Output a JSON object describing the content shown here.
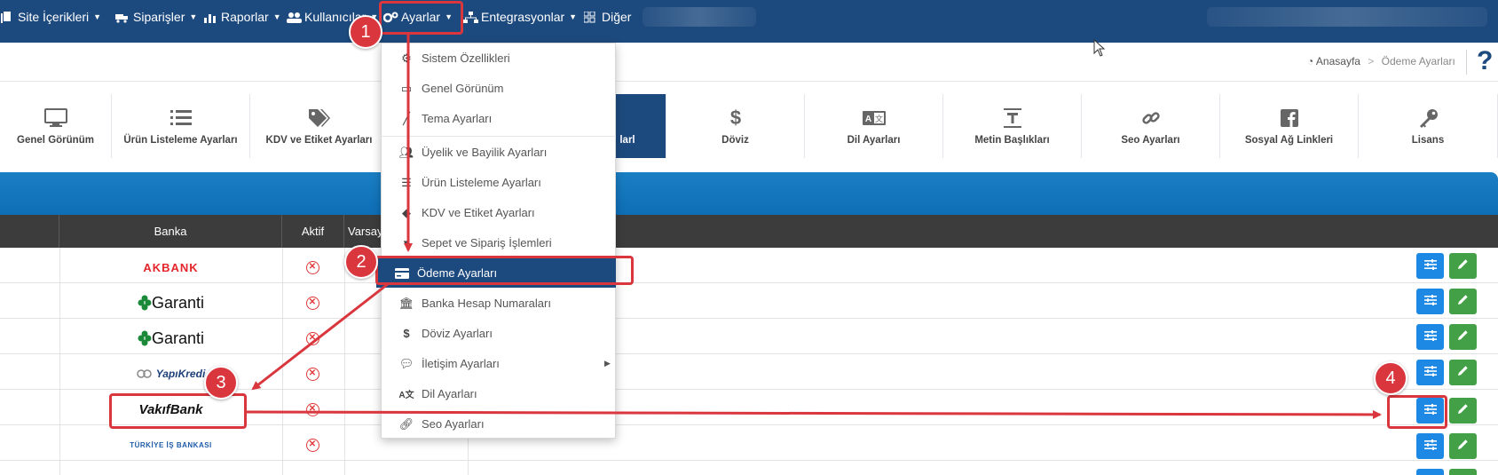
{
  "topnav": {
    "items": [
      {
        "label": "Site İçerikleri",
        "icon": "document-icon"
      },
      {
        "label": "Siparişler",
        "icon": "truck-icon"
      },
      {
        "label": "Raporlar",
        "icon": "chart-icon"
      },
      {
        "label": "Kullanıcılar",
        "icon": "users-icon"
      },
      {
        "label": "Ayarlar",
        "icon": "gears-icon"
      },
      {
        "label": "Entegrasyonlar",
        "icon": "sitemap-icon"
      },
      {
        "label": "Diğer",
        "icon": "grid-icon"
      }
    ]
  },
  "breadcrumb": {
    "home": "Anasayfa",
    "separator": ">",
    "current": "Ödeme Ayarları"
  },
  "help_label": "?",
  "tabs": [
    {
      "label": "Genel Görünüm",
      "icon": "monitor-icon"
    },
    {
      "label": "Ürün Listeleme Ayarları",
      "icon": "list-icon"
    },
    {
      "label": "KDV ve Etiket Ayarları",
      "icon": "tags-icon"
    },
    {
      "label": "larl",
      "icon": ""
    },
    {
      "label": "Döviz",
      "icon": "dollar-icon"
    },
    {
      "label": "Dil Ayarları",
      "icon": "language-icon"
    },
    {
      "label": "Metin Başlıkları",
      "icon": "text-height-icon"
    },
    {
      "label": "Seo Ayarları",
      "icon": "link-icon"
    },
    {
      "label": "Sosyal Ağ Linkleri",
      "icon": "facebook-icon"
    },
    {
      "label": "Lisans",
      "icon": "key-icon"
    }
  ],
  "table": {
    "headers": {
      "bank": "Banka",
      "active": "Aktif",
      "default": "Varsay"
    },
    "rows": [
      {
        "bank": "AKBANK",
        "logo": "akbank",
        "active_symbol": "✕"
      },
      {
        "bank": "Garanti",
        "logo": "garanti",
        "active_symbol": "✕"
      },
      {
        "bank": "Garanti",
        "logo": "garanti",
        "active_symbol": "✕"
      },
      {
        "bank": "YapıKredi",
        "logo": "yapikredi",
        "active_symbol": "✕"
      },
      {
        "bank": "VakıfBank",
        "logo": "vakifbank",
        "active_symbol": "✕"
      },
      {
        "bank": "TÜRKİYE İŞ BANKASI",
        "logo": "isbank",
        "active_symbol": "✕"
      }
    ]
  },
  "dropdown": {
    "items": [
      {
        "label": "Sistem Özellikleri",
        "icon": "gears-icon"
      },
      {
        "label": "Genel Görünüm",
        "icon": "monitor-icon"
      },
      {
        "label": "Tema Ayarları",
        "icon": "brush-icon"
      },
      {
        "label": "Üyelik ve Bayilik Ayarları",
        "icon": "users-icon"
      },
      {
        "label": "Ürün Listeleme Ayarları",
        "icon": "list-icon"
      },
      {
        "label": "KDV ve Etiket Ayarları",
        "icon": "tags-icon"
      },
      {
        "label": "Sepet ve Sipariş İşlemleri",
        "icon": "basket-icon"
      },
      {
        "label": "Ödeme Ayarları",
        "icon": "credit-card-icon"
      },
      {
        "label": "Banka Hesap Numaraları",
        "icon": "bank-icon"
      },
      {
        "label": "Döviz Ayarları",
        "icon": "dollar-icon"
      },
      {
        "label": "İletişim Ayarları",
        "icon": "comments-icon"
      },
      {
        "label": "Dil Ayarları",
        "icon": "language-icon"
      },
      {
        "label": "Seo Ayarları",
        "icon": "link-icon"
      }
    ]
  },
  "annotations": {
    "badges": [
      "1",
      "2",
      "3",
      "4"
    ],
    "color": "#d9363e"
  },
  "colors": {
    "nav": "#1d4a7e",
    "panel": "#0e6eb6",
    "table_head": "#3c3c3c",
    "settings_button": "#1e88e5",
    "edit_button": "#43a047",
    "inactive_icon": "#e03a3a"
  }
}
